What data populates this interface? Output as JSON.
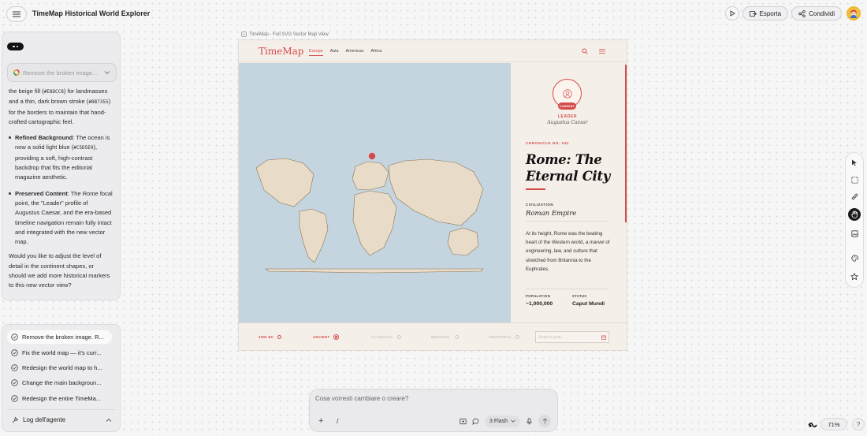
{
  "app": {
    "title": "TimeMap Historical World Explorer"
  },
  "topbar": {
    "export_label": "Esporta",
    "share_label": "Condividi"
  },
  "chat": {
    "dropdown_label": "Remove the broken image...",
    "intro": "the beige fill (",
    "code_fill": "#E8DCC8",
    "intro_2": ") for landmasses and a thin, dark brown stroke (",
    "code_stroke": "#8B7355",
    "intro_3": ") for the borders to maintain that hand-crafted cartographic feel.",
    "bullets": [
      {
        "title": "Refined Background",
        "text_1": ": The ocean is now a solid light blue (",
        "code": "#C5D5E0",
        "text_2": "), providing a soft, high-contrast backdrop that fits the editorial magazine aesthetic."
      },
      {
        "title": "Preserved Content",
        "text_1": ": The Rome focal point, the \"Leader\" profile of Augustus Caesar, and the era-based timeline navigation remain fully intact and integrated with the new vector map.",
        "code": "",
        "text_2": ""
      }
    ],
    "closing": "Would you like to adjust the level of detail in the continent shapes, or should we add more historical markers to this new vector view?"
  },
  "history": {
    "items": [
      "Remove the broken image. R...",
      "Fix the world map — it's curr...",
      "Redesign the world map to h...",
      "Change the main backgroun...",
      "Redesign the entire TimeMa..."
    ],
    "agent_log_label": "Log dell'agente"
  },
  "preview": {
    "file_label": "TimeMap - Full SVG Vector Map View",
    "logo": "TimeMap",
    "nav": [
      "Europe",
      "Asia",
      "Americas",
      "Africa"
    ],
    "leader": {
      "badge": "CURRENT",
      "label": "LEADER",
      "name": "Augustus Caesar"
    },
    "chronicle": "CHRONICLE NO. 042",
    "headline_1": "Rome: The",
    "headline_2": "Eternal City",
    "civilization_label": "CIVILIZATION",
    "civilization_value": "Roman Empire",
    "paragraph": "At its height, Rome was the beating heart of the Western world, a marvel of engineering, law, and culture that stretched from Britannia to the Euphrates.",
    "stats": [
      {
        "label": "POPULATION",
        "value": "~1,000,000"
      },
      {
        "label": "STATUS",
        "value": "Caput Mundi"
      }
    ],
    "timeline": {
      "eras": [
        "3000 BC",
        "ANCIENT",
        "CLASSICAL",
        "MEDIEVAL",
        "INDUSTRIAL"
      ],
      "active": "ANCIENT",
      "jump_placeholder": "Jump to year..."
    },
    "colors": {
      "accent": "#D44A4A",
      "land": "#E8DCC8",
      "stroke": "#8B7355",
      "ocean": "#C5D5E0",
      "paper": "#F5EFE9"
    }
  },
  "composer": {
    "placeholder": "Cosa vorresti cambiare o creare?",
    "model_label": "3 Flash"
  },
  "status": {
    "zoom": "71%",
    "help": "?"
  },
  "icons": [
    "menu-icon",
    "play-icon",
    "export-icon",
    "share-icon",
    "avatar-icon",
    "chevron-down-icon",
    "check-circle-icon",
    "agent-icon",
    "chevron-up-icon",
    "file-icon",
    "search-icon",
    "hamburger-icon",
    "user-icon",
    "calendar-icon",
    "cursor-icon",
    "selection-icon",
    "ruler-icon",
    "hand-icon",
    "image-icon",
    "palette-icon",
    "star-icon",
    "plus-icon",
    "slash-icon",
    "attach-icon",
    "chat-icon",
    "mic-icon",
    "arrow-up-icon",
    "spark-icon"
  ]
}
